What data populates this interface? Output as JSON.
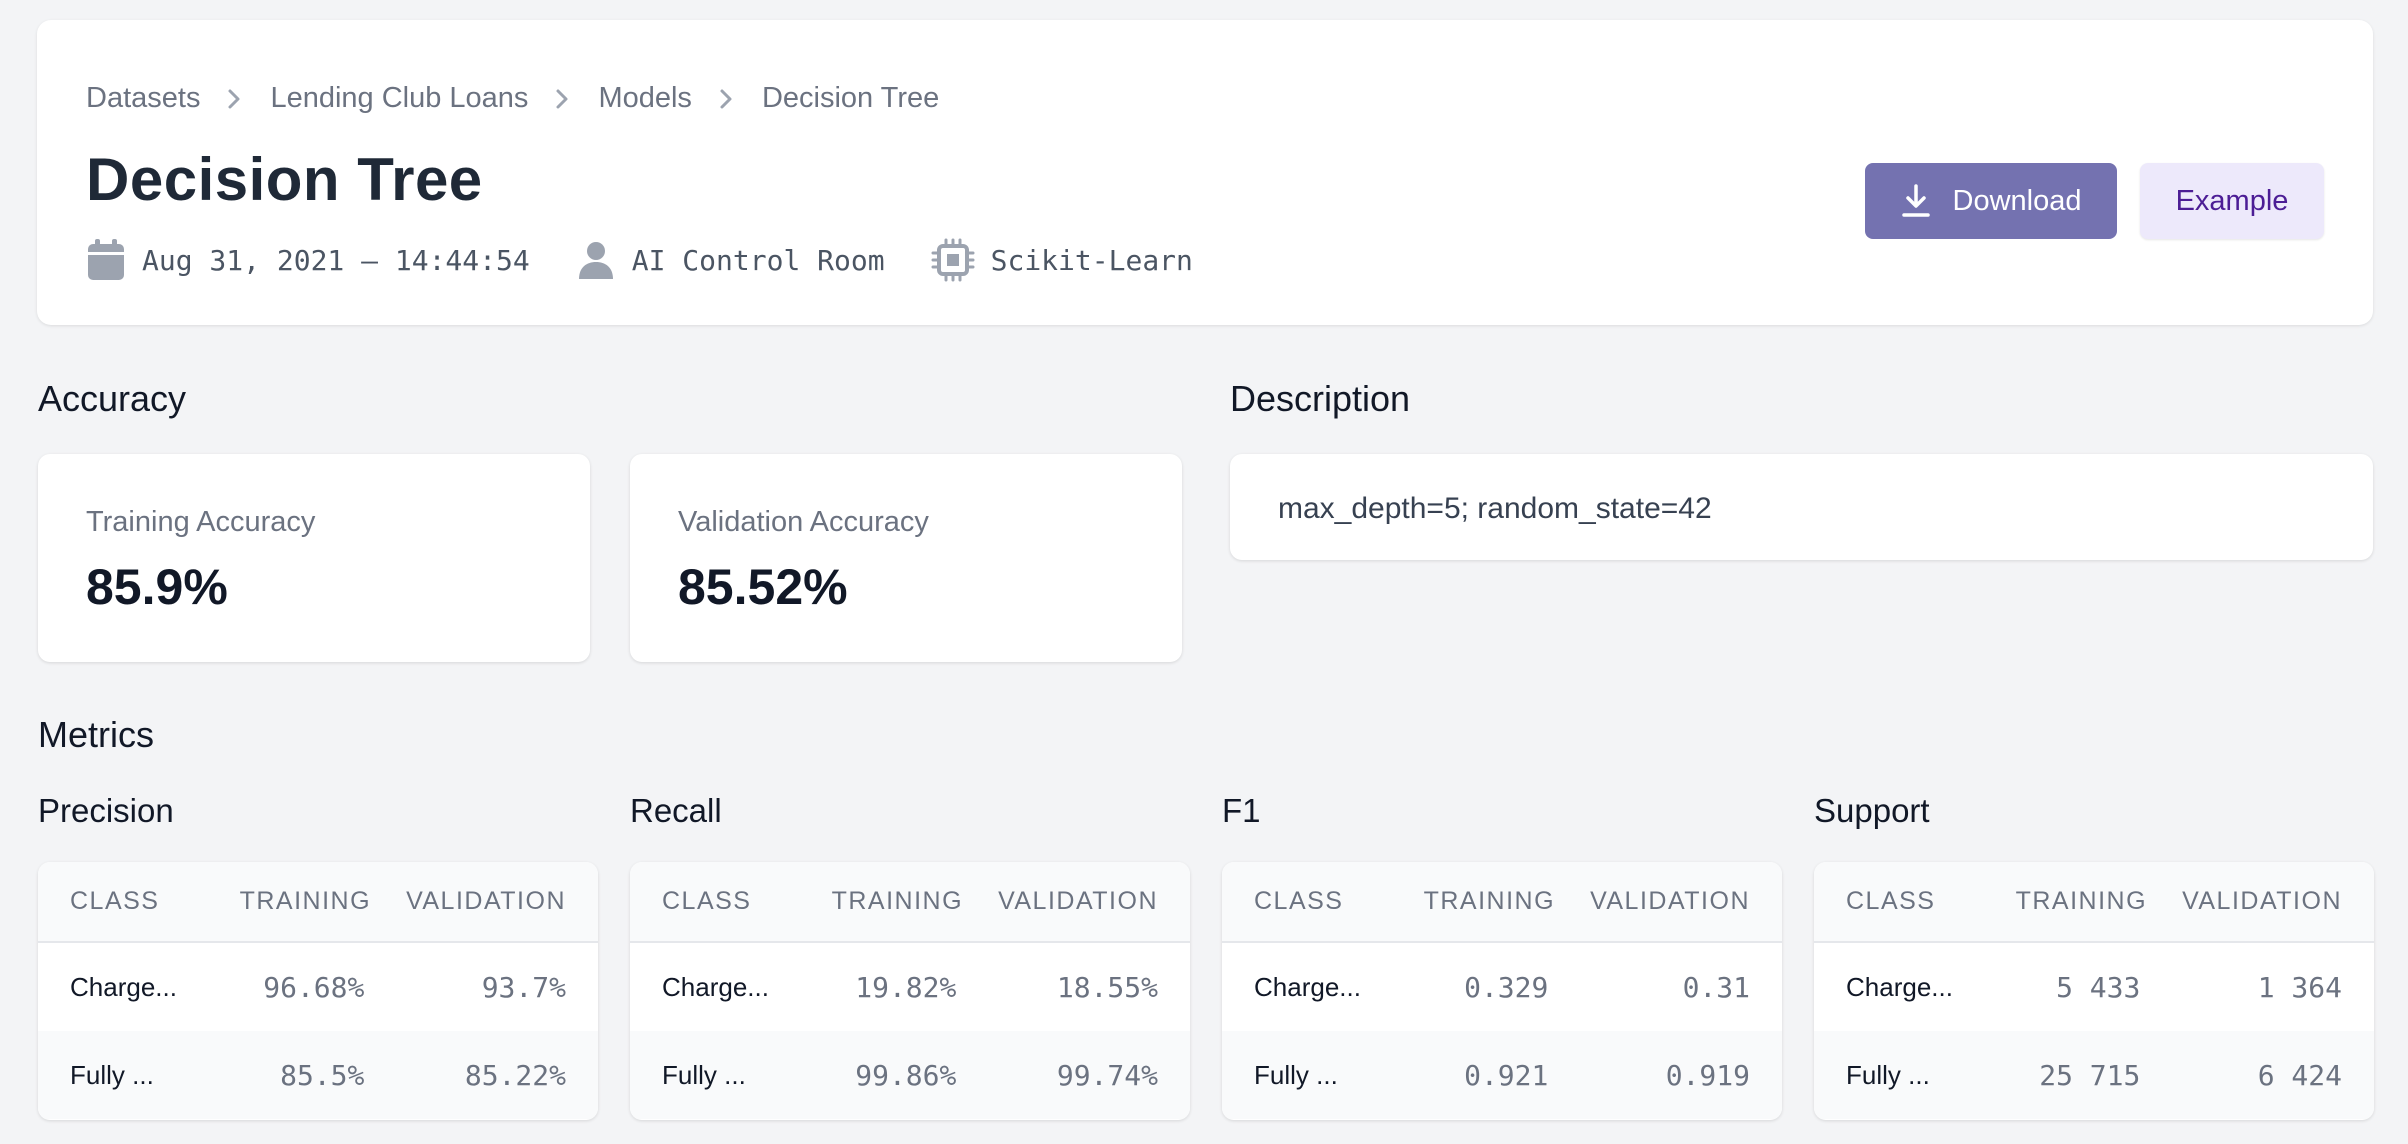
{
  "breadcrumb": [
    "Datasets",
    "Lending Club Loans",
    "Models",
    "Decision Tree"
  ],
  "title": "Decision Tree",
  "meta": {
    "date": "Aug 31, 2021 — 14:44:54",
    "owner": "AI Control Room",
    "framework": "Scikit-Learn"
  },
  "buttons": {
    "download": "Download",
    "example": "Example"
  },
  "accuracy": {
    "heading": "Accuracy",
    "training_label": "Training Accuracy",
    "training_value": "85.9%",
    "validation_label": "Validation Accuracy",
    "validation_value": "85.52%"
  },
  "description": {
    "heading": "Description",
    "text": "max_depth=5; random_state=42"
  },
  "metrics": {
    "heading": "Metrics",
    "columns": [
      "CLASS",
      "TRAINING",
      "VALIDATION"
    ],
    "precision": {
      "title": "Precision",
      "rows": [
        [
          "Charge...",
          "96.68%",
          "93.7%"
        ],
        [
          "Fully ...",
          "85.5%",
          "85.22%"
        ]
      ]
    },
    "recall": {
      "title": "Recall",
      "rows": [
        [
          "Charge...",
          "19.82%",
          "18.55%"
        ],
        [
          "Fully ...",
          "99.86%",
          "99.74%"
        ]
      ]
    },
    "f1": {
      "title": "F1",
      "rows": [
        [
          "Charge...",
          "0.329",
          "0.31"
        ],
        [
          "Fully ...",
          "0.921",
          "0.919"
        ]
      ]
    },
    "support": {
      "title": "Support",
      "rows": [
        [
          "Charge...",
          "5 433",
          "1 364"
        ],
        [
          "Fully ...",
          "25 715",
          "6 424"
        ]
      ]
    }
  },
  "colors": {
    "primary_button": "#7472b0",
    "secondary_button": "#ede9fb",
    "secondary_button_text": "#4c1d95",
    "background": "#f3f4f6"
  },
  "icons": {
    "date": "calendar-icon",
    "owner": "user-icon",
    "framework": "cpu-chip-icon",
    "download": "download-icon",
    "separator": "chevron-right-icon"
  }
}
